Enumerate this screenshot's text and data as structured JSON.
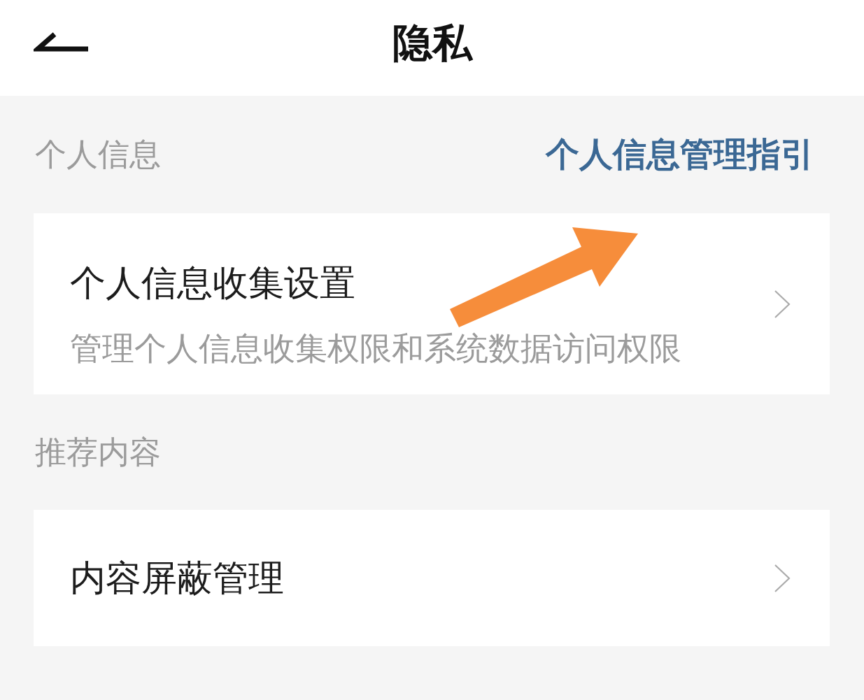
{
  "header": {
    "title": "隐私"
  },
  "sections": [
    {
      "heading": "个人信息",
      "link": "个人信息管理指引",
      "items": [
        {
          "title": "个人信息收集设置",
          "description": "管理个人信息收集权限和系统数据访问权限"
        }
      ]
    },
    {
      "heading": "推荐内容",
      "items": [
        {
          "title": "内容屏蔽管理"
        }
      ]
    }
  ],
  "annotations": [
    {
      "kind": "arrow"
    }
  ]
}
